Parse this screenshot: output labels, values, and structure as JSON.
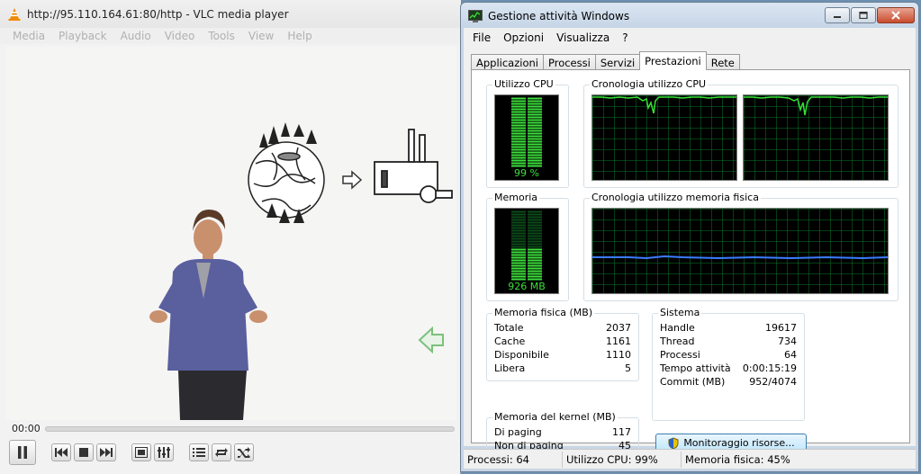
{
  "vlc": {
    "title": "http://95.110.164.61:80/http - VLC media player",
    "menu": [
      "Media",
      "Playback",
      "Audio",
      "Video",
      "Tools",
      "View",
      "Help"
    ],
    "time": "00:00",
    "seek_progress": 0
  },
  "taskmanager": {
    "title": "Gestione attività Windows",
    "menu": [
      "File",
      "Opzioni",
      "Visualizza",
      "?"
    ],
    "tabs": [
      "Applicazioni",
      "Processi",
      "Servizi",
      "Prestazioni",
      "Rete"
    ],
    "active_tab": "Prestazioni",
    "cpu_usage": {
      "title": "Utilizzo CPU",
      "value": "99 %",
      "level": 99
    },
    "cpu_history": {
      "title": "Cronologia utilizzo CPU"
    },
    "memory": {
      "title": "Memoria",
      "value": "926 MB",
      "level": 45
    },
    "memory_history": {
      "title": "Cronologia utilizzo memoria fisica"
    },
    "physical_memory": {
      "title": "Memoria fisica (MB)",
      "rows": [
        {
          "label": "Totale",
          "value": "2037"
        },
        {
          "label": "Cache",
          "value": "1161"
        },
        {
          "label": "Disponibile",
          "value": "1110"
        },
        {
          "label": "Libera",
          "value": "5"
        }
      ]
    },
    "kernel_memory": {
      "title": "Memoria del kernel (MB)",
      "rows": [
        {
          "label": "Di paging",
          "value": "117"
        },
        {
          "label": "Non di paging",
          "value": "45"
        }
      ]
    },
    "system": {
      "title": "Sistema",
      "rows": [
        {
          "label": "Handle",
          "value": "19617"
        },
        {
          "label": "Thread",
          "value": "734"
        },
        {
          "label": "Processi",
          "value": "64"
        },
        {
          "label": "Tempo attività",
          "value": "0:00:15:19"
        },
        {
          "label": "Commit (MB)",
          "value": "952/4074"
        }
      ]
    },
    "resource_button": "Monitoraggio risorse...",
    "status": {
      "processes": "Processi: 64",
      "cpu": "Utilizzo CPU: 99%",
      "memory": "Memoria fisica: 45%"
    }
  },
  "colors": {
    "meter_green": "#3be03b",
    "graph_grid": "#0a7a2a",
    "cpu_line": "#35e035",
    "mem_line": "#3a7cff"
  }
}
